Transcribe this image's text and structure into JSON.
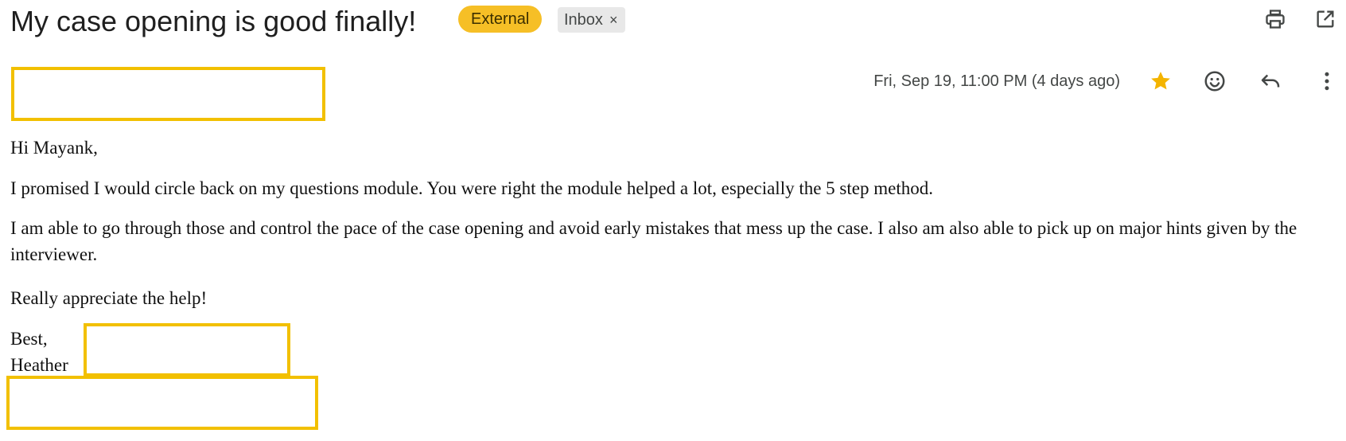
{
  "email": {
    "subject": "My case opening is good finally!",
    "labels": {
      "external": "External",
      "inbox": "Inbox",
      "inbox_remove": "×"
    },
    "timestamp": "Fri, Sep 19, 11:00 PM (4 days ago)",
    "starred": true,
    "body": {
      "greeting": "Hi Mayank,",
      "paragraph1": "I promised I would circle back on my questions module. You were right the module helped a lot, especially the 5 step method.",
      "paragraph2": "I am able to go through those and control the pace of the case opening and avoid early mistakes that mess up the case. I also am also able to pick up on major hints given by the interviewer.",
      "paragraph3": "Really appreciate the help!",
      "signoff": "Best,",
      "name": "Heather"
    }
  },
  "icons": {
    "print": "print-icon",
    "popout": "open-in-new-window-icon",
    "star": "star-icon",
    "emoji": "emoji-reaction-icon",
    "reply": "reply-icon",
    "more": "more-vertical-icon"
  },
  "colors": {
    "external_label": "#f6bf26",
    "inbox_label": "#e8e8e8",
    "star": "#f4b400",
    "redaction_border": "#f2c000"
  }
}
